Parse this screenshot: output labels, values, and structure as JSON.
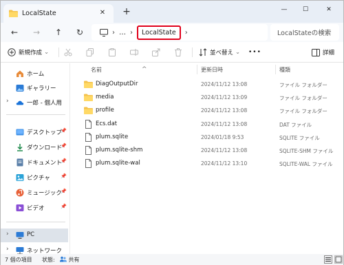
{
  "tab": {
    "title": "LocalState",
    "close_glyph": "✕",
    "new_tab_glyph": "+"
  },
  "window": {
    "minimize": "—",
    "maximize": "☐",
    "close": "✕"
  },
  "address": {
    "back": "←",
    "forward": "→",
    "up": "↑",
    "refresh": "↻",
    "more": "…",
    "current": "LocalState",
    "search_placeholder": "LocalStateの検索"
  },
  "toolbar": {
    "new_label": "新規作成",
    "new_chevron": "⌄",
    "sort_label": "並べ替え",
    "sort_chevron": "⌄",
    "more": "•••",
    "details_label": "詳細"
  },
  "sidebar": {
    "items": [
      {
        "label": "ホーム",
        "icon": "home-icon"
      },
      {
        "label": "ギャラリー",
        "icon": "gallery-icon"
      },
      {
        "label": "一郎 - 個人用",
        "icon": "onedrive-icon",
        "chevron": "›"
      },
      {
        "label": "デスクトップ",
        "icon": "desktop-icon",
        "pin": "📌"
      },
      {
        "label": "ダウンロード",
        "icon": "download-icon",
        "pin": "📌"
      },
      {
        "label": "ドキュメント",
        "icon": "documents-icon",
        "pin": "📌"
      },
      {
        "label": "ピクチャ",
        "icon": "pictures-icon",
        "pin": "📌"
      },
      {
        "label": "ミュージック",
        "icon": "music-icon",
        "pin": "📌"
      },
      {
        "label": "ビデオ",
        "icon": "videos-icon",
        "pin": "📌"
      },
      {
        "label": "PC",
        "icon": "pc-icon",
        "chevron": "›"
      },
      {
        "label": "ネットワーク",
        "icon": "network-icon",
        "chevron": "›"
      }
    ]
  },
  "columns": {
    "name": "名前",
    "date": "更新日時",
    "type": "種類",
    "sort_indicator": "^"
  },
  "files": [
    {
      "name": "DiagOutputDir",
      "date": "2024/11/12 13:08",
      "type": "ファイル フォルダー",
      "kind": "folder"
    },
    {
      "name": "media",
      "date": "2024/11/12 13:09",
      "type": "ファイル フォルダー",
      "kind": "folder"
    },
    {
      "name": "profile",
      "date": "2024/11/12 13:08",
      "type": "ファイル フォルダー",
      "kind": "folder"
    },
    {
      "name": "Ecs.dat",
      "date": "2024/11/12 13:08",
      "type": "DAT ファイル",
      "kind": "file"
    },
    {
      "name": "plum.sqlite",
      "date": "2024/01/18 9:53",
      "type": "SQLITE ファイル",
      "kind": "file"
    },
    {
      "name": "plum.sqlite-shm",
      "date": "2024/11/12 13:08",
      "type": "SQLITE-SHM ファイル",
      "kind": "file"
    },
    {
      "name": "plum.sqlite-wal",
      "date": "2024/11/12 13:10",
      "type": "SQLITE-WAL ファイル",
      "kind": "file"
    }
  ],
  "status": {
    "count": "7 個の項目",
    "state_label": "状態:",
    "state_value": "共有"
  },
  "colors": {
    "accent": "#0067c0",
    "folder": "#f4c24d",
    "highlight": "#e0001b"
  }
}
